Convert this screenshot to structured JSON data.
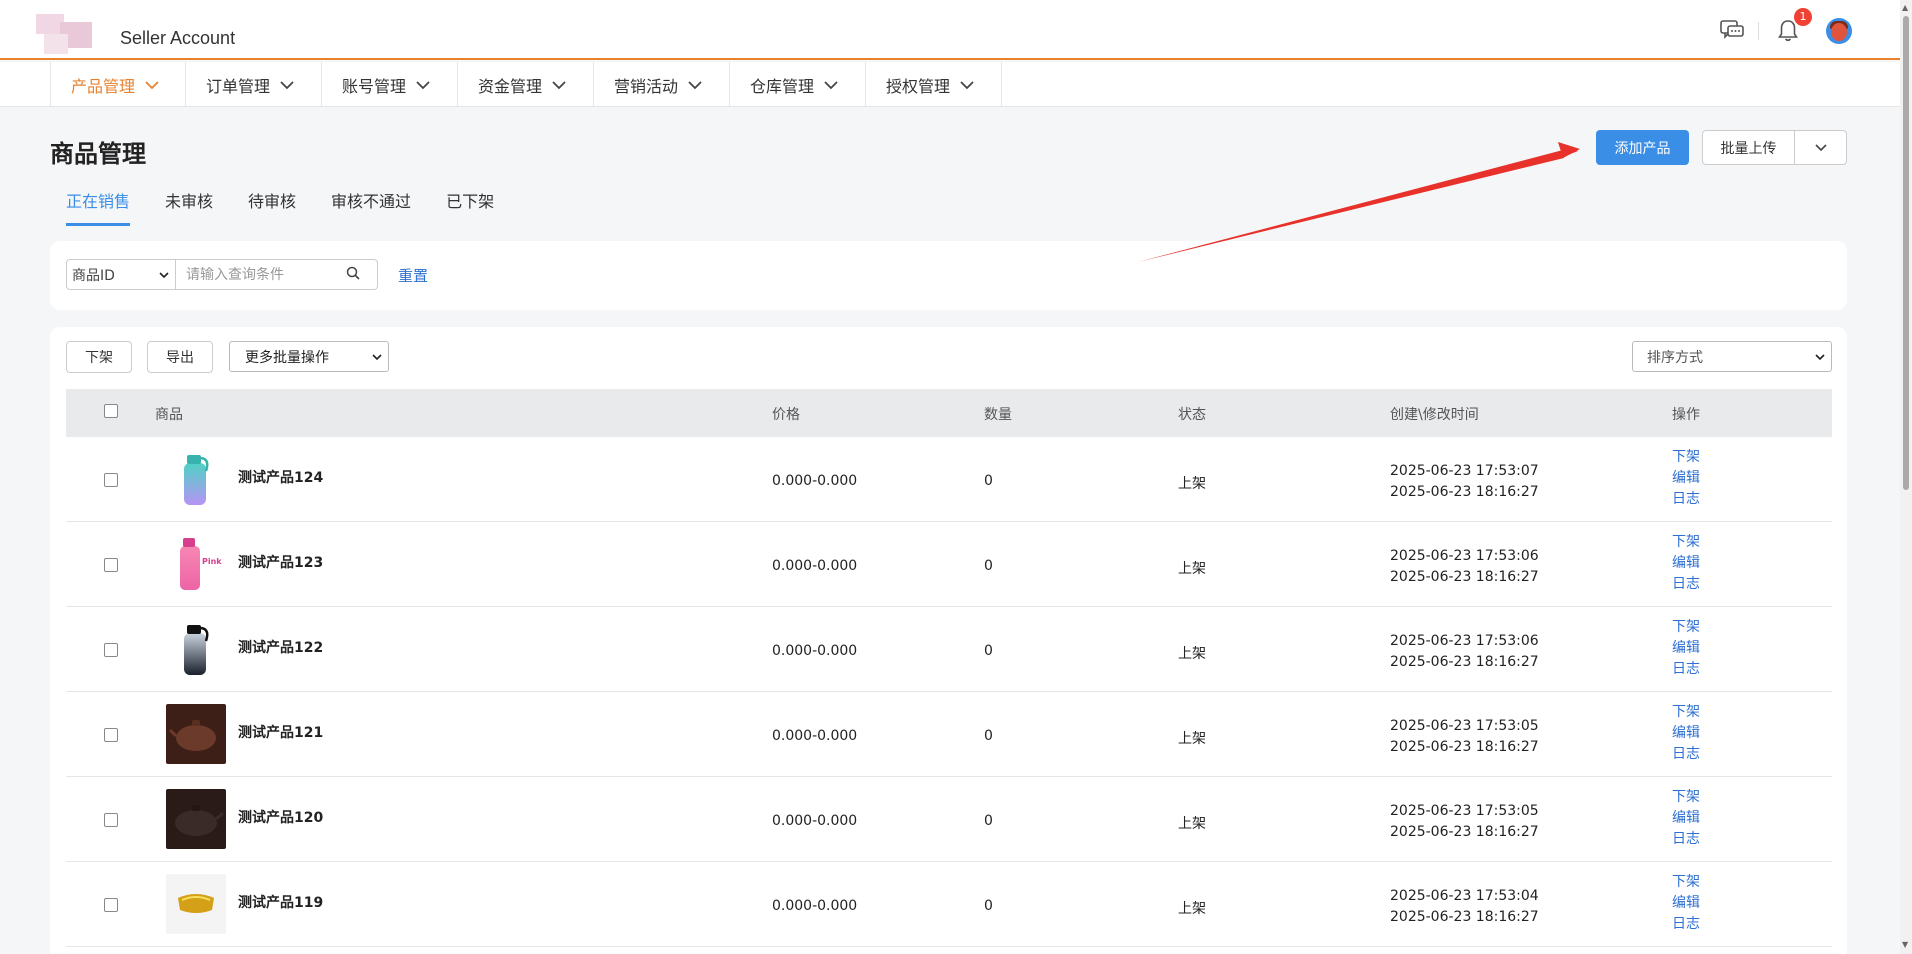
{
  "header": {
    "app_title": "Seller Account",
    "notification_count": "1"
  },
  "nav": {
    "items": [
      {
        "label": "产品管理",
        "active": true
      },
      {
        "label": "订单管理"
      },
      {
        "label": "账号管理"
      },
      {
        "label": "资金管理"
      },
      {
        "label": "营销活动"
      },
      {
        "label": "仓库管理"
      },
      {
        "label": "授权管理"
      }
    ]
  },
  "page": {
    "title": "商品管理",
    "add_product_label": "添加产品",
    "batch_upload_label": "批量上传"
  },
  "tabs": [
    {
      "label": "正在销售",
      "active": true
    },
    {
      "label": "未审核"
    },
    {
      "label": "待审核"
    },
    {
      "label": "审核不通过"
    },
    {
      "label": "已下架"
    }
  ],
  "search": {
    "field_selected": "商品ID",
    "placeholder": "请输入查询条件",
    "reset_label": "重置"
  },
  "toolbar": {
    "delist_label": "下架",
    "export_label": "导出",
    "bulk_ops_selected": "更多批量操作",
    "sort_selected": "排序方式"
  },
  "table": {
    "columns": {
      "product": "商品",
      "price": "价格",
      "quantity": "数量",
      "status": "状态",
      "time": "创建\\修改时间",
      "actions": "操作"
    },
    "actions": {
      "delist": "下架",
      "edit": "编辑",
      "log": "日志"
    },
    "rows": [
      {
        "name": "测试产品124",
        "price": "0.000-0.000",
        "qty": "0",
        "status": "上架",
        "created": "2025-06-23 17:53:07",
        "modified": "2025-06-23 18:16:27",
        "thumb": "bottle-teal"
      },
      {
        "name": "测试产品123",
        "price": "0.000-0.000",
        "qty": "0",
        "status": "上架",
        "created": "2025-06-23 17:53:06",
        "modified": "2025-06-23 18:16:27",
        "thumb": "bottle-pink",
        "thumb_text": "Pink"
      },
      {
        "name": "测试产品122",
        "price": "0.000-0.000",
        "qty": "0",
        "status": "上架",
        "created": "2025-06-23 17:53:06",
        "modified": "2025-06-23 18:16:27",
        "thumb": "bottle-black"
      },
      {
        "name": "测试产品121",
        "price": "0.000-0.000",
        "qty": "0",
        "status": "上架",
        "created": "2025-06-23 17:53:05",
        "modified": "2025-06-23 18:16:27",
        "thumb": "teapot-brown"
      },
      {
        "name": "测试产品120",
        "price": "0.000-0.000",
        "qty": "0",
        "status": "上架",
        "created": "2025-06-23 17:53:05",
        "modified": "2025-06-23 18:16:27",
        "thumb": "teapot-dark"
      },
      {
        "name": "测试产品119",
        "price": "0.000-0.000",
        "qty": "0",
        "status": "上架",
        "created": "2025-06-23 17:53:04",
        "modified": "2025-06-23 18:16:27",
        "thumb": "gold-bracelet"
      }
    ]
  },
  "colors": {
    "accent": "#e8822f",
    "primary": "#3a8ee6",
    "link": "#2d6fd2",
    "annotation_arrow": "#e8312a"
  }
}
